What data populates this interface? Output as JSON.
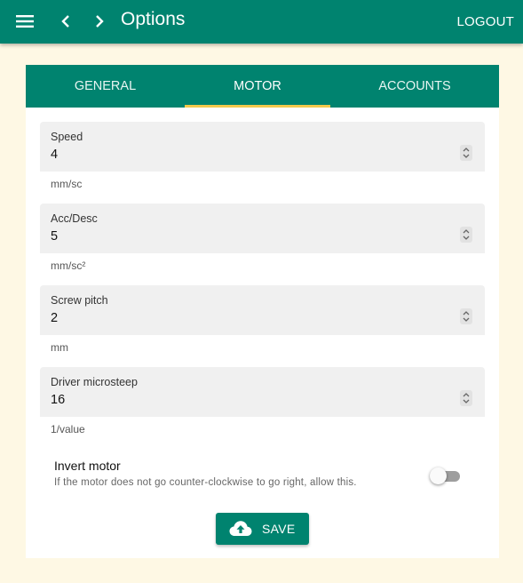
{
  "appbar": {
    "title": "Options",
    "logout_label": "LOGOUT",
    "icons": [
      "menu-icon",
      "chevron-left-icon",
      "chevron-right-icon"
    ],
    "color": "#00836f"
  },
  "tabs": [
    {
      "label": "GENERAL",
      "active": false
    },
    {
      "label": "MOTOR",
      "active": true
    },
    {
      "label": "ACCOUNTS",
      "active": false
    }
  ],
  "fields": [
    {
      "label": "Speed",
      "value": "4",
      "hint": "mm/sc"
    },
    {
      "label": "Acc/Desc",
      "value": "5",
      "hint": "mm/sc²"
    },
    {
      "label": "Screw pitch",
      "value": "2",
      "hint": "mm"
    },
    {
      "label": "Driver microsteep",
      "value": "16",
      "hint": "1/value"
    }
  ],
  "invert": {
    "title": "Invert motor",
    "description": "If the motor does not go counter-clockwise to go right, allow this.",
    "enabled": false
  },
  "save": {
    "label": "SAVE",
    "icon": "cloud-upload-icon"
  },
  "colors": {
    "primary": "#00836f",
    "tab_indicator": "#f2c94c",
    "background": "#fef8e4"
  }
}
